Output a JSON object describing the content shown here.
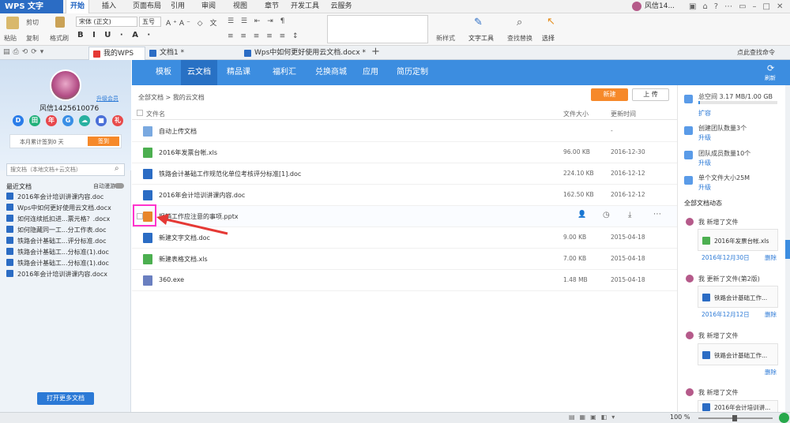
{
  "app": {
    "logo_text": "WPS 文字"
  },
  "menus": [
    "开始",
    "插入",
    "页面布局",
    "引用",
    "审阅",
    "视图",
    "章节",
    "开发工具",
    "云服务"
  ],
  "user_top": "风信14...",
  "ribbon": {
    "paste": "粘贴",
    "cut": "剪切",
    "copy": "复制",
    "format_brush": "格式刷",
    "font_name": "宋体 (正文)",
    "font_size": "五号",
    "styles": "新样式",
    "text_tools": "文字工具",
    "find_replace": "查找替换",
    "select": "选择"
  },
  "doc_tabs": [
    "我的WPS",
    "文档1 *",
    "Wps中如何更好使用云文档.docx *"
  ],
  "quick_search": "点此查找命令",
  "left": {
    "username": "风信1425610076",
    "upgrade": "升级会员",
    "signin_text": "本月累计签到0 天",
    "signin_btn": "签到",
    "search_placeholder": "搜文档（本地文档+云文档）",
    "recent_label": "最近文档",
    "auto_roam": "自动漫游",
    "recent": [
      "2016年会计培训讲课内容.doc",
      "Wps中如何更好使用云文档.docx",
      "如何连续抵扣进...票元格？.docx",
      "如何隐藏同一工...分工作表.doc",
      "铁路会计基础工...评分标准.doc",
      "铁路会计基础工...分标准(1).doc",
      "铁路会计基础工...分标准(1).doc",
      "2016年会计培训讲课内容.docx"
    ],
    "open_more": "打开更多文档",
    "circle_icons": [
      {
        "t": "D",
        "c": "#2b7de9"
      },
      {
        "t": "田",
        "c": "#21b07a"
      },
      {
        "t": "年",
        "c": "#e8474c"
      },
      {
        "t": "G",
        "c": "#3a8fe6"
      },
      {
        "t": "☁",
        "c": "#28b0a0"
      },
      {
        "t": "■",
        "c": "#4a6fd8"
      },
      {
        "t": "礼",
        "c": "#e84b4b"
      }
    ]
  },
  "nav": [
    "模板",
    "云文档",
    "精品课",
    "福利汇",
    "兑换商城",
    "应用",
    "简历定制"
  ],
  "refresh": "刷新",
  "breadcrumb": "全部文档  >  我的云文档",
  "buttons": {
    "new": "新建",
    "upload": "上 传"
  },
  "table": {
    "headers": {
      "name": "文件名",
      "size": "文件大小",
      "time": "更新时间"
    },
    "rows": [
      {
        "name": "自动上传文档",
        "size": "",
        "time": "-",
        "icon": "folder"
      },
      {
        "name": "2016年发票台帐.xls",
        "size": "96.00 KB",
        "time": "2016-12-30",
        "icon": "xls"
      },
      {
        "name": "铁路会计基础工作规范化单位考核评分标准[1].doc",
        "size": "224.10 KB",
        "time": "2016-12-12",
        "icon": "doc"
      },
      {
        "name": "2016年会计培训讲课内容.doc",
        "size": "162.50 KB",
        "time": "2016-12-12",
        "icon": "doc"
      },
      {
        "name": "报销工作应注意的事项.pptx",
        "size": "",
        "time": "",
        "icon": "ppt"
      },
      {
        "name": "新建文字文档.doc",
        "size": "9.00 KB",
        "time": "2015-04-18",
        "icon": "doc"
      },
      {
        "name": "新建表格文档.xls",
        "size": "7.00 KB",
        "time": "2015-04-18",
        "icon": "xls"
      },
      {
        "name": "360.exe",
        "size": "1.48 MB",
        "time": "2015-04-18",
        "icon": "exe"
      }
    ]
  },
  "right": {
    "space": "总空间 3.17 MB/1.00 GB",
    "expand": "扩容",
    "teams": "创建团队数量3个",
    "members": "团队成员数量10个",
    "single": "单个文件大小25M",
    "upgrade": "升级",
    "feed_title": "全部文档动态",
    "feed": [
      {
        "action": "我 新增了文件",
        "file": "2016年发票台帐.xls",
        "date": "2016年12月30日",
        "icon": "xls"
      },
      {
        "action": "我 更新了文件(第2版)",
        "file": "铁路会计基础工作...",
        "date": "2016年12月12日",
        "icon": "doc"
      },
      {
        "action": "我 新增了文件",
        "file": "铁路会计基础工作...",
        "date": "",
        "icon": "doc"
      },
      {
        "action": "我 新增了文件",
        "file": "2016年会计培训讲...",
        "date": "",
        "icon": "doc"
      }
    ],
    "delete": "删除"
  },
  "status": {
    "zoom": "100 %"
  },
  "colors": {
    "accent": "#3c8de0",
    "orange": "#f6892a",
    "highlight": "#ff33cc",
    "arrow": "#e53935"
  }
}
